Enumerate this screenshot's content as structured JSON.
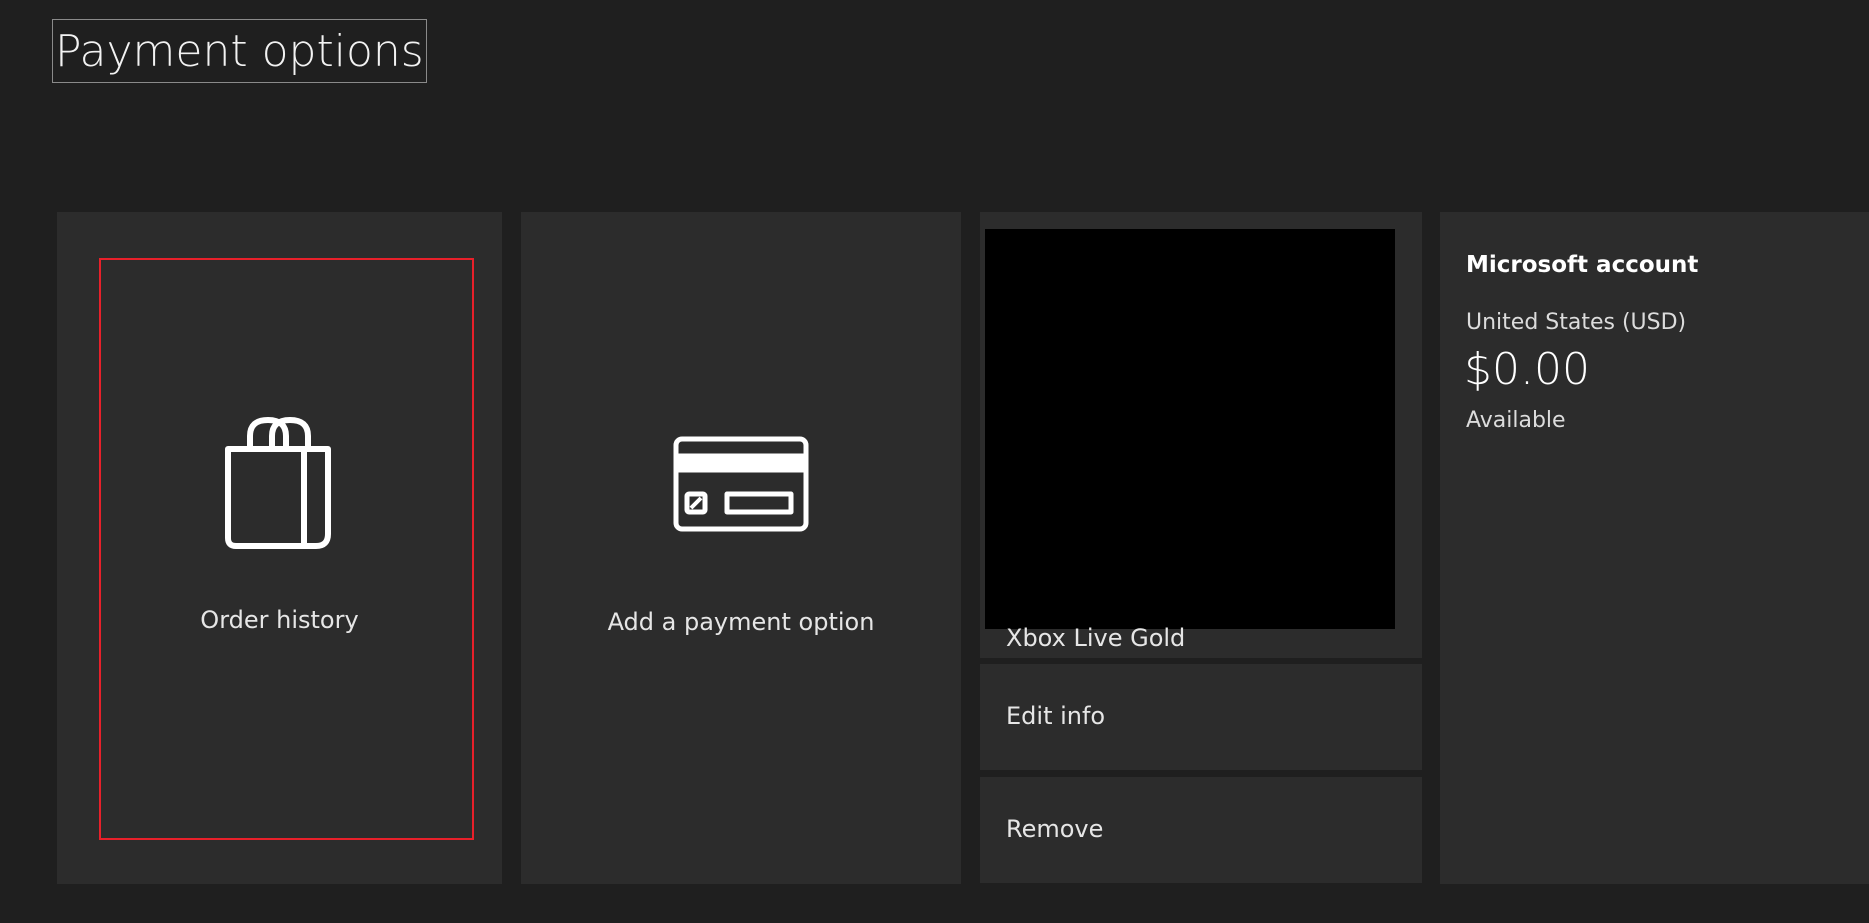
{
  "page": {
    "title": "Payment options"
  },
  "tiles": {
    "order_history": {
      "label": "Order history",
      "icon": "shopping-bag-icon",
      "focused": true
    },
    "add_payment": {
      "label": "Add a payment option",
      "icon": "credit-card-icon"
    },
    "payment_method": {
      "name": "Xbox Live Gold",
      "edit_label": "Edit info",
      "remove_label": "Remove"
    },
    "account": {
      "title": "Microsoft account",
      "region": "United States (USD)",
      "balance": "$0.00",
      "status": "Available"
    }
  },
  "colors": {
    "background": "#1f1f1f",
    "tile": "#2c2c2c",
    "focus": "#e8202a",
    "text": "#ffffff"
  }
}
